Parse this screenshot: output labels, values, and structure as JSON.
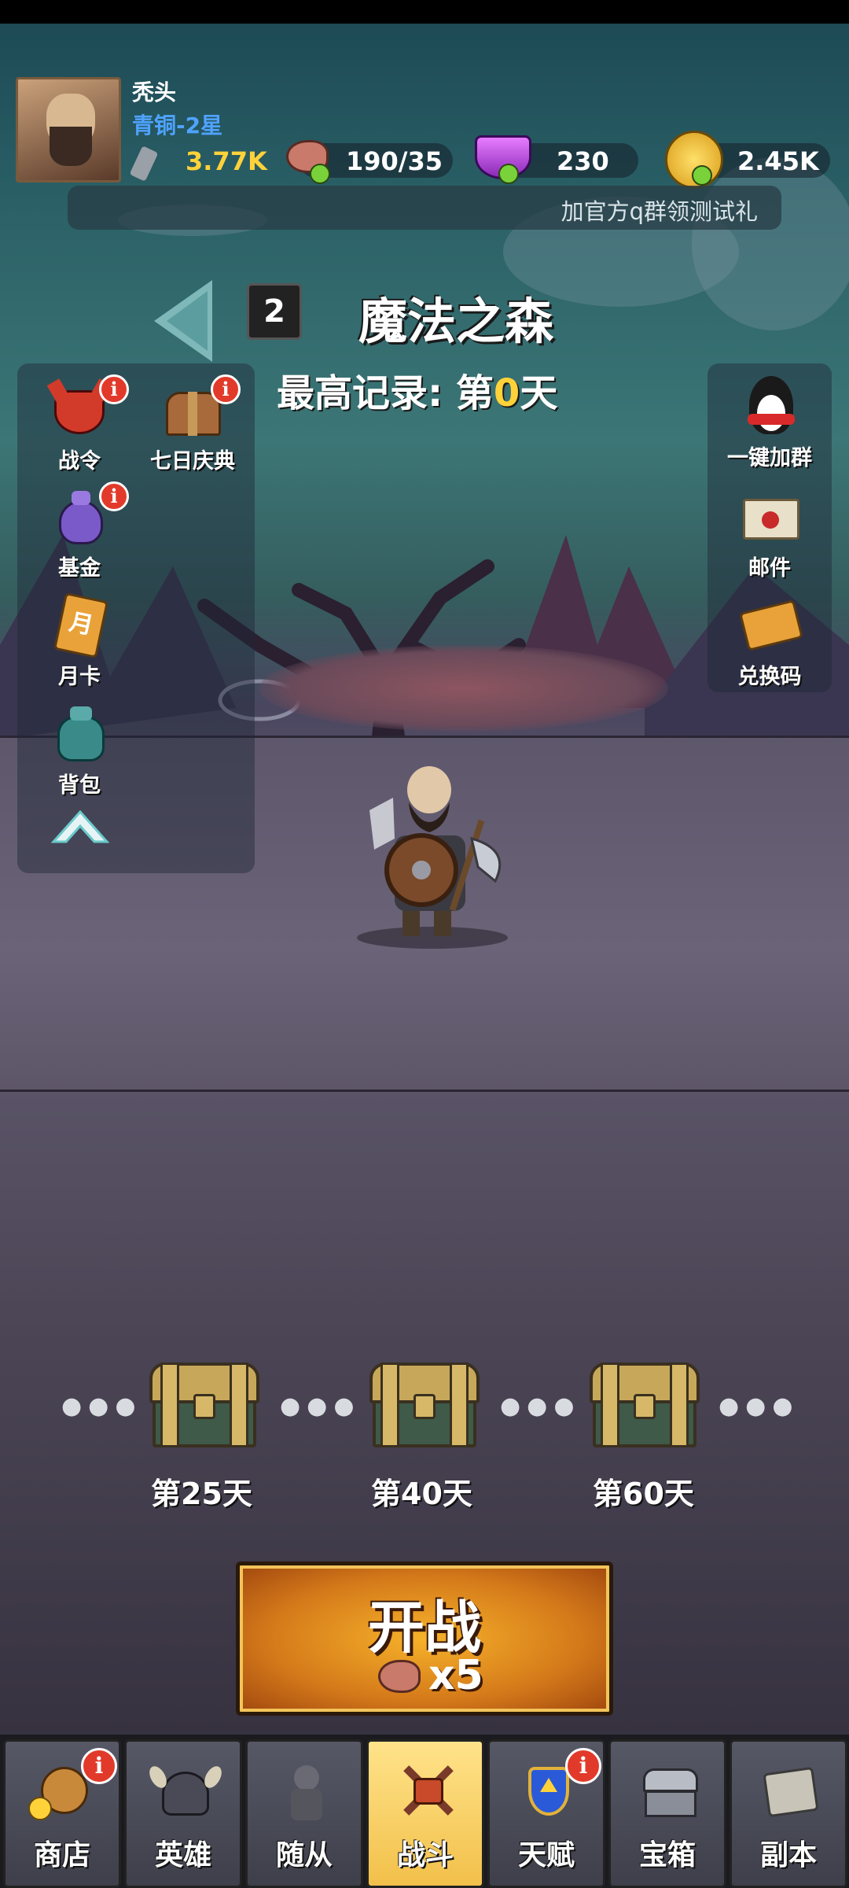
{
  "player": {
    "name": "秃头",
    "rank": "青铜-2星"
  },
  "resources": {
    "attack": "3.77K",
    "stamina": "190/35",
    "gems": "230",
    "gold": "2.45K"
  },
  "notice": "加官方q群领测试礼",
  "stage": {
    "number": "2",
    "name": "魔法之森",
    "record_prefix": "最高记录: 第",
    "record_day": "0",
    "record_suffix": "天"
  },
  "left_menu": [
    {
      "label": "战令",
      "badge": "i"
    },
    {
      "label": "七日庆典",
      "badge": "i"
    },
    {
      "label": "基金",
      "badge": "i"
    },
    {
      "label": "月卡",
      "icon_text": "月"
    },
    {
      "label": "背包"
    }
  ],
  "right_menu": [
    {
      "label": "一键加群"
    },
    {
      "label": "邮件"
    },
    {
      "label": "兑换码"
    }
  ],
  "milestones": [
    {
      "label": "第25天"
    },
    {
      "label": "第40天"
    },
    {
      "label": "第60天"
    }
  ],
  "dots": "●●●",
  "start_button": {
    "label": "开战",
    "cost": "x5"
  },
  "nav": [
    {
      "label": "商店",
      "badge": "i"
    },
    {
      "label": "英雄"
    },
    {
      "label": "随从"
    },
    {
      "label": "战斗",
      "active": true
    },
    {
      "label": "天赋",
      "badge": "i"
    },
    {
      "label": "宝箱"
    },
    {
      "label": "副本"
    }
  ],
  "colors": {
    "rank_blue": "#4fa3ff",
    "gold_text": "#ffd23a",
    "badge_red": "#e23a2a",
    "active_tab": "#f2c04a"
  }
}
